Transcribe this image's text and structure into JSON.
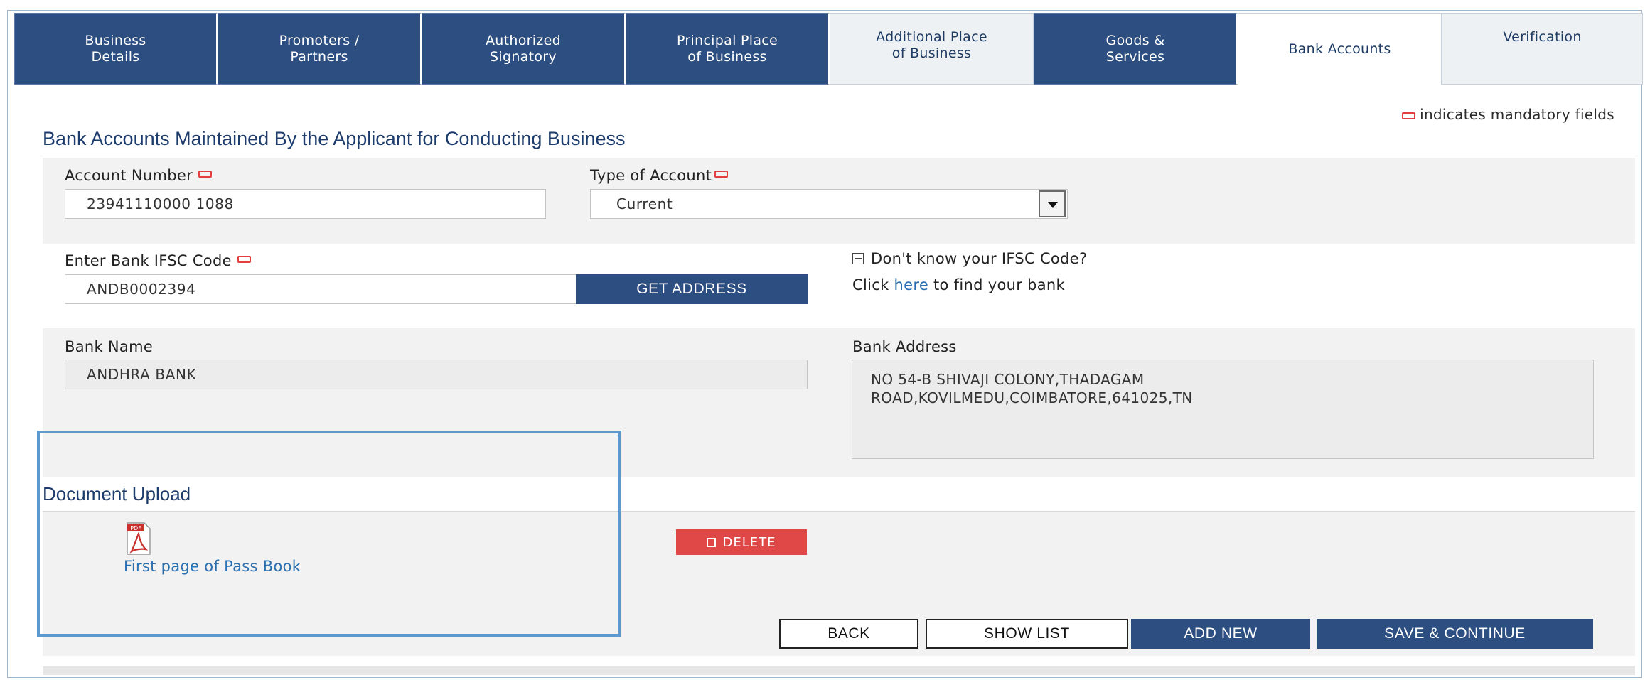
{
  "tabs": [
    {
      "label": "Business\nDetails"
    },
    {
      "label": "Promoters /\nPartners"
    },
    {
      "label": "Authorized\nSignatory"
    },
    {
      "label": "Principal Place\nof Business"
    },
    {
      "label": "Additional Place\nof Business"
    },
    {
      "label": "Goods &\nServices"
    },
    {
      "label": "Bank Accounts"
    },
    {
      "label": "Verification"
    }
  ],
  "mandatory_note": "indicates mandatory fields",
  "section_title": "Bank Accounts Maintained By the Applicant for Conducting Business",
  "account_number": {
    "label": "Account Number",
    "value": "23941110000 1088"
  },
  "account_type": {
    "label": "Type of Account",
    "value": "Current"
  },
  "ifsc": {
    "label": "Enter Bank IFSC Code",
    "value": "ANDB0002394",
    "button": "GET ADDRESS"
  },
  "ifsc_help": {
    "question": "Don't know your IFSC Code?",
    "prefix": "Click ",
    "link": "here",
    "suffix": " to find your bank"
  },
  "bank_name": {
    "label": "Bank Name",
    "value": "ANDHRA BANK"
  },
  "bank_address": {
    "label": "Bank Address",
    "line1": "NO 54-B SHIVAJI COLONY,THADAGAM",
    "line2": "ROAD,KOVILMEDU,COIMBATORE,641025,TN"
  },
  "document": {
    "title": "Document Upload",
    "file_label": "First page of Pass Book",
    "icon_text": "PDF",
    "delete_label": "DELETE"
  },
  "actions": {
    "back": "BACK",
    "show_list": "SHOW LIST",
    "add_new": "ADD NEW",
    "save_continue": "SAVE & CONTINUE"
  },
  "colors": {
    "nav_blue": "#2c4e80",
    "link_blue": "#2a6fb0",
    "required_red": "#e53e3e",
    "delete_red": "#e04848",
    "highlight_blue": "#5d98cf"
  }
}
